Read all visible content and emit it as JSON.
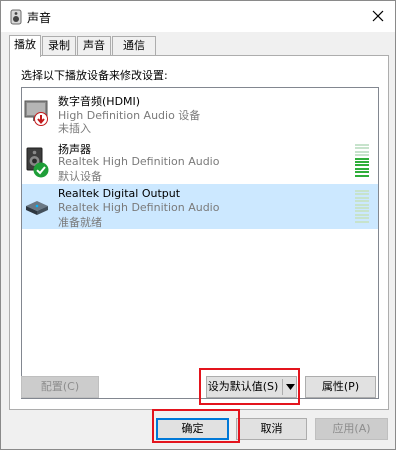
{
  "window": {
    "title": "声音",
    "icon": "speaker-icon",
    "close_icon": "close-icon"
  },
  "tabs": [
    {
      "label": "播放",
      "active": true
    },
    {
      "label": "录制",
      "active": false
    },
    {
      "label": "声音",
      "active": false
    },
    {
      "label": "通信",
      "active": false
    }
  ],
  "instruction": "选择以下播放设备来修改设置:",
  "devices": [
    {
      "name": "数字音频(HDMI)",
      "driver": "High Definition Audio 设备",
      "status": "未插入",
      "icon": "hdmi-monitor-icon",
      "badge": "unplugged-red-arrow-icon",
      "selected": false
    },
    {
      "name": "扬声器",
      "driver": "Realtek High Definition Audio",
      "status": "默认设备",
      "icon": "speaker-device-icon",
      "badge": "default-green-check-icon",
      "selected": false,
      "level_fraction": 0.6
    },
    {
      "name": "Realtek Digital Output",
      "driver": "Realtek High Definition Audio",
      "status": "准备就绪",
      "icon": "digital-output-icon",
      "selected": true,
      "level_fraction": 0
    }
  ],
  "buttons": {
    "configure": "配置(C)",
    "set_default": "设为默认值(S)",
    "properties": "属性(P)",
    "ok": "确定",
    "cancel": "取消",
    "apply": "应用(A)"
  },
  "colors": {
    "selection": "#cce8ff",
    "highlight_box": "#e3141d",
    "level_active": "#2fae3a",
    "level_inactive": "#c7e3cc"
  }
}
